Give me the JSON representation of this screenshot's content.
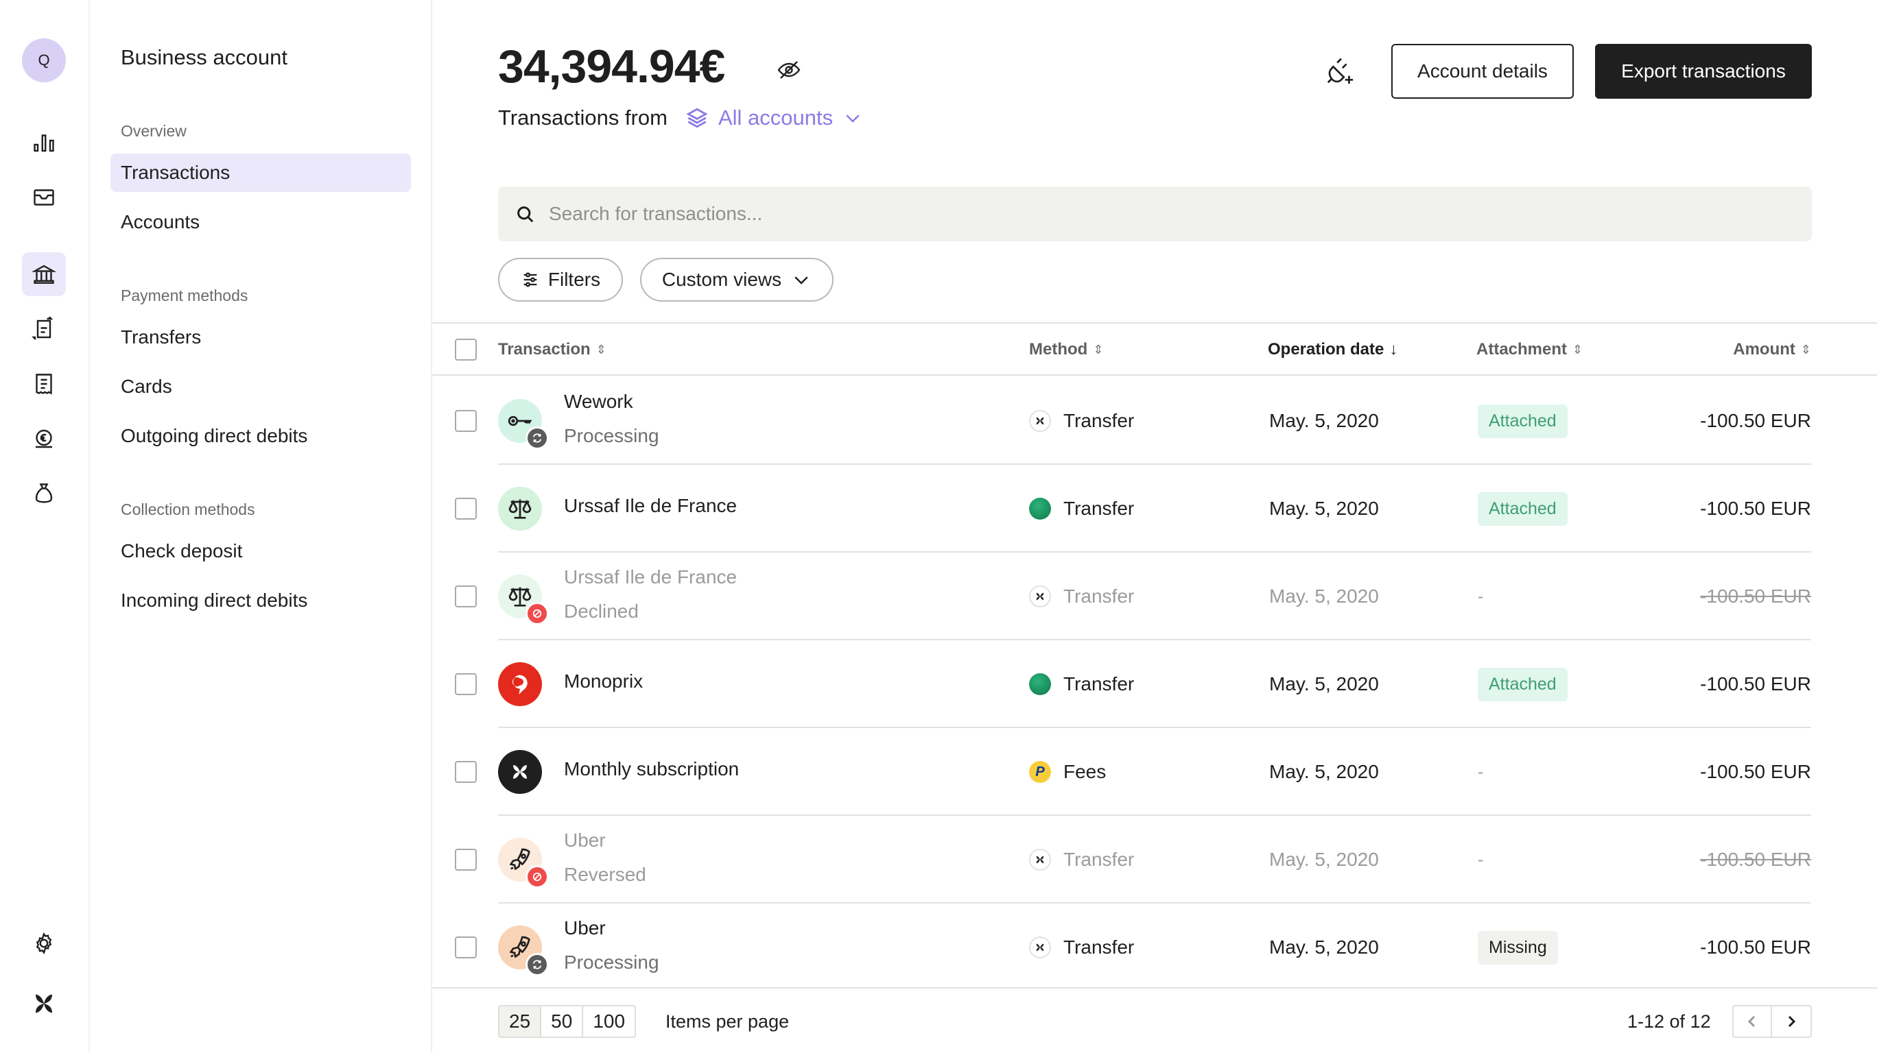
{
  "rail": {
    "avatar_initial": "Q",
    "icons": [
      "analytics-icon",
      "inbox-icon",
      "bank-icon",
      "transfers-icon",
      "receipt-icon",
      "euro-bag-icon",
      "money-bag-icon",
      "settings-icon",
      "logo-icon"
    ],
    "active_icon": "bank-icon"
  },
  "subnav": {
    "title": "Business account",
    "sections": [
      {
        "label": "Overview",
        "items": [
          {
            "label": "Transactions",
            "active": true
          },
          {
            "label": "Accounts"
          }
        ]
      },
      {
        "label": "Payment methods",
        "items": [
          {
            "label": "Transfers"
          },
          {
            "label": "Cards"
          },
          {
            "label": "Outgoing direct debits"
          }
        ]
      },
      {
        "label": "Collection methods",
        "items": [
          {
            "label": "Check deposit"
          },
          {
            "label": "Incoming direct debits"
          }
        ]
      }
    ]
  },
  "header": {
    "balance": "34,394.94€",
    "hide_balance_icon": "eye-off-icon",
    "transactions_from_label": "Transactions from",
    "account_selector": "All accounts",
    "connect_icon": "plug-add-icon",
    "account_details_label": "Account details",
    "export_label": "Export transactions"
  },
  "search": {
    "placeholder": "Search for transactions...",
    "value": ""
  },
  "filters": {
    "filters_label": "Filters",
    "custom_views_label": "Custom views"
  },
  "table": {
    "columns": [
      {
        "label": "Transaction",
        "sort": "none"
      },
      {
        "label": "Method",
        "sort": "none"
      },
      {
        "label": "Operation date",
        "sort": "desc"
      },
      {
        "label": "Attachment",
        "sort": "none"
      },
      {
        "label": "Amount",
        "sort": "none"
      }
    ],
    "rows": [
      {
        "name": "Wework",
        "status": "Processing",
        "avatar": "key-icon",
        "avatar_bg": "#d3f3e6",
        "badge": "processing",
        "method": "Transfer",
        "method_icon": "qonto-icon",
        "date": "May. 5, 2020",
        "attachment": "Attached",
        "amount": "-100.50 EUR",
        "muted": false
      },
      {
        "name": "Urssaf Ile de France",
        "status": "",
        "avatar": "scales-icon",
        "avatar_bg": "#d5f2dc",
        "badge": "",
        "method": "Transfer",
        "method_icon": "bnp-icon",
        "date": "May. 5, 2020",
        "attachment": "Attached",
        "amount": "-100.50 EUR",
        "muted": false
      },
      {
        "name": "Urssaf Ile de France",
        "status": "Declined",
        "avatar": "scales-icon",
        "avatar_bg": "#e7f7ec",
        "badge": "declined",
        "method": "Transfer",
        "method_icon": "qonto-icon",
        "date": "May. 5, 2020",
        "attachment": "-",
        "amount": "-100.50 EUR",
        "muted": true
      },
      {
        "name": "Monoprix",
        "status": "",
        "avatar": "monoprix-logo-icon",
        "avatar_bg": "#e32a1c",
        "badge": "",
        "method": "Transfer",
        "method_icon": "bnp-icon",
        "date": "May. 5, 2020",
        "attachment": "Attached",
        "amount": "-100.50 EUR",
        "muted": false
      },
      {
        "name": "Monthly subscription",
        "status": "",
        "avatar": "qonto-logo-icon",
        "avatar_bg": "#1f1f1f",
        "badge": "",
        "method": "Fees",
        "method_icon": "paypal-icon",
        "date": "May. 5, 2020",
        "attachment": "-",
        "amount": "-100.50 EUR",
        "muted": false
      },
      {
        "name": "Uber",
        "status": "Reversed",
        "avatar": "rocket-icon",
        "avatar_bg": "#fcebdc",
        "badge": "declined",
        "method": "Transfer",
        "method_icon": "qonto-icon",
        "date": "May. 5, 2020",
        "attachment": "-",
        "amount": "-100.50 EUR",
        "muted": true
      },
      {
        "name": "Uber",
        "status": "Processing",
        "avatar": "rocket-icon",
        "avatar_bg": "#f9d3b6",
        "badge": "processing",
        "method": "Transfer",
        "method_icon": "qonto-icon",
        "date": "May. 5, 2020",
        "attachment": "Missing",
        "amount": "-100.50 EUR",
        "muted": false
      }
    ]
  },
  "pagination": {
    "per_page_options": [
      "25",
      "50",
      "100"
    ],
    "per_page_selected": "25",
    "per_page_label": "Items per page",
    "range": "1-12 of 12"
  },
  "colors": {
    "accent": "#8b7be6",
    "accent_bg": "#ece8fb",
    "attached_bg": "#e1f6ec",
    "attached_text": "#3e9f74",
    "declined": "#ef4b4b",
    "processing": "#5a5a5a"
  }
}
